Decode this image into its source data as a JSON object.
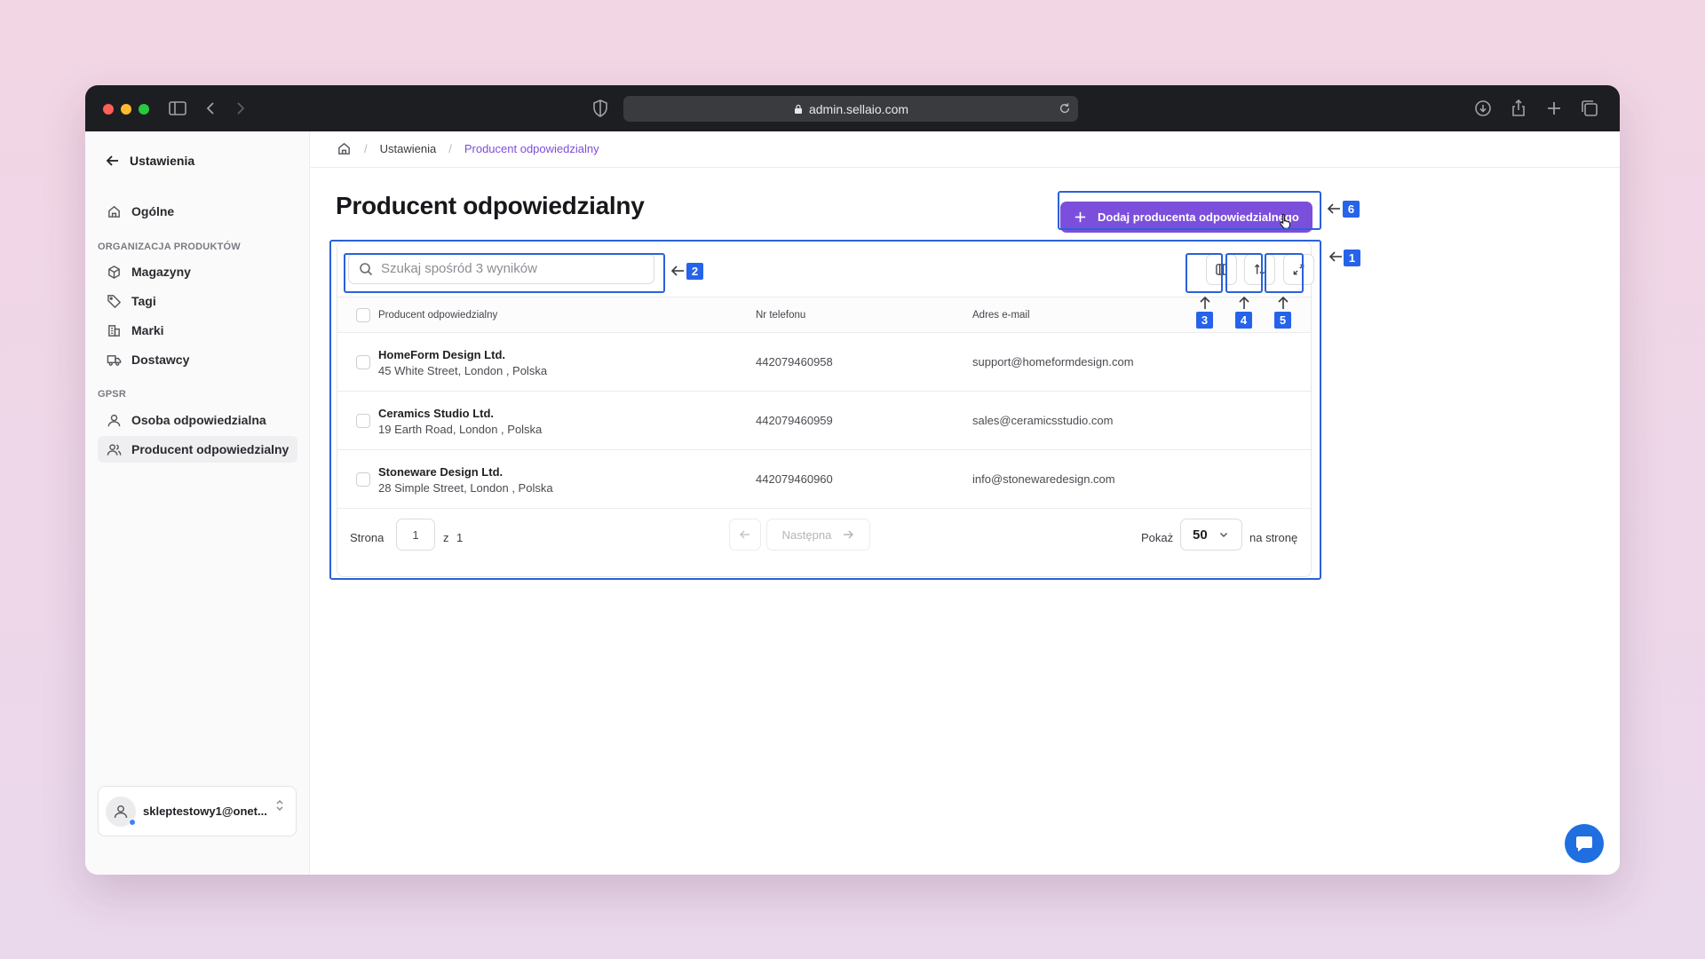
{
  "browser": {
    "url": "admin.sellaio.com"
  },
  "sidebar": {
    "back_label": "Ustawienia",
    "general_label": "Ogólne",
    "section_products": "ORGANIZACJA PRODUKTÓW",
    "products_items": [
      {
        "label": "Magazyny",
        "icon": "box-icon"
      },
      {
        "label": "Tagi",
        "icon": "tag-icon"
      },
      {
        "label": "Marki",
        "icon": "building-icon"
      },
      {
        "label": "Dostawcy",
        "icon": "truck-icon"
      }
    ],
    "section_gpsr": "GPSR",
    "gpsr_items": [
      {
        "label": "Osoba odpowiedzialna",
        "icon": "user-icon"
      },
      {
        "label": "Producent odpowiedzialny",
        "icon": "users-icon",
        "active": true
      }
    ],
    "user_email": "skleptestowy1@onet..."
  },
  "breadcrumb": {
    "items": [
      "Ustawienia",
      "Producent odpowiedzialny"
    ]
  },
  "page": {
    "title": "Producent odpowiedzialny",
    "add_button_label": "Dodaj producenta odpowiedzialnego"
  },
  "table": {
    "search_placeholder": "Szukaj spośród 3 wyników",
    "columns": [
      "Producent odpowiedzialny",
      "Nr telefonu",
      "Adres e-mail"
    ],
    "rows": [
      {
        "name": "HomeForm Design Ltd.",
        "address": "45 White Street, London , Polska",
        "phone": "442079460958",
        "email": "support@homeformdesign.com"
      },
      {
        "name": "Ceramics Studio Ltd.",
        "address": "19 Earth Road, London , Polska",
        "phone": "442079460959",
        "email": "sales@ceramicsstudio.com"
      },
      {
        "name": "Stoneware Design Ltd.",
        "address": "28 Simple Street, London , Polska",
        "phone": "442079460960",
        "email": "info@stonewaredesign.com"
      }
    ]
  },
  "pagination": {
    "page_label": "Strona",
    "current_page": "1",
    "of_label": "z",
    "total_pages": "1",
    "next_label": "Następna",
    "show_label": "Pokaż",
    "per_page": "50",
    "per_page_suffix": "na stronę"
  },
  "annotations": {
    "labels": [
      "1",
      "2",
      "3",
      "4",
      "5",
      "6"
    ]
  },
  "colors": {
    "accent": "#7b4fdc",
    "annotation": "#2563eb"
  }
}
